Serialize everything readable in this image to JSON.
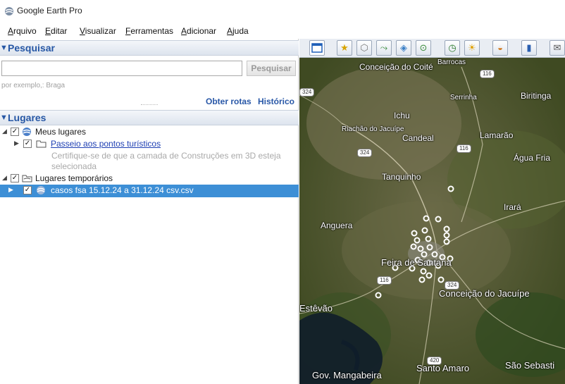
{
  "window": {
    "title": "Google Earth Pro"
  },
  "menu": [
    "Arquivo",
    "Editar",
    "Visualizar",
    "Ferramentas",
    "Adicionar",
    "Ajuda"
  ],
  "search": {
    "header": "Pesquisar",
    "input_value": "",
    "button": "Pesquisar",
    "hint": "por exemplo,: Braga",
    "directions": "Obter rotas",
    "history": "Histórico"
  },
  "places": {
    "header": "Lugares",
    "my_places": "Meus lugares",
    "tour": "Passeio aos pontos turísticos",
    "tour_note_1": "Certifique-se de que a camada de Construções em 3D esteja",
    "tour_note_2": "selecionada",
    "temp_places": "Lugares temporários",
    "file": "casos fsa 15.12.24 a 31.12.24 csv.csv"
  },
  "map": {
    "labels": {
      "conceicao_coite": "Conceição do Coité",
      "barrocas": "Barrocas",
      "serrinha": "Serrinha",
      "biritinga": "Biritinga",
      "ichu": "Ichu",
      "riachao": "Riachão do Jacuípe",
      "candeal": "Candeal",
      "lamarao": "Lamarão",
      "agua_fria": "Água Fria",
      "tanquinho": "Tanquinho",
      "irara": "Irará",
      "anguera": "Anguera",
      "feira": "Feira de Santana",
      "conceicao_jacuipe": "Conceição do Jacuípe",
      "estevao": "Estêvão",
      "gov_mangabeira": "Gov. Mangabeira",
      "santo_amaro": "Santo Amaro",
      "sao_sebastiao": "São Sebasti"
    },
    "shields": {
      "s116a": "116",
      "s324a": "324",
      "s116b": "116",
      "s324b": "324",
      "s116c": "116",
      "s324c": "324",
      "s420": "420",
      "s324d": "324"
    }
  }
}
